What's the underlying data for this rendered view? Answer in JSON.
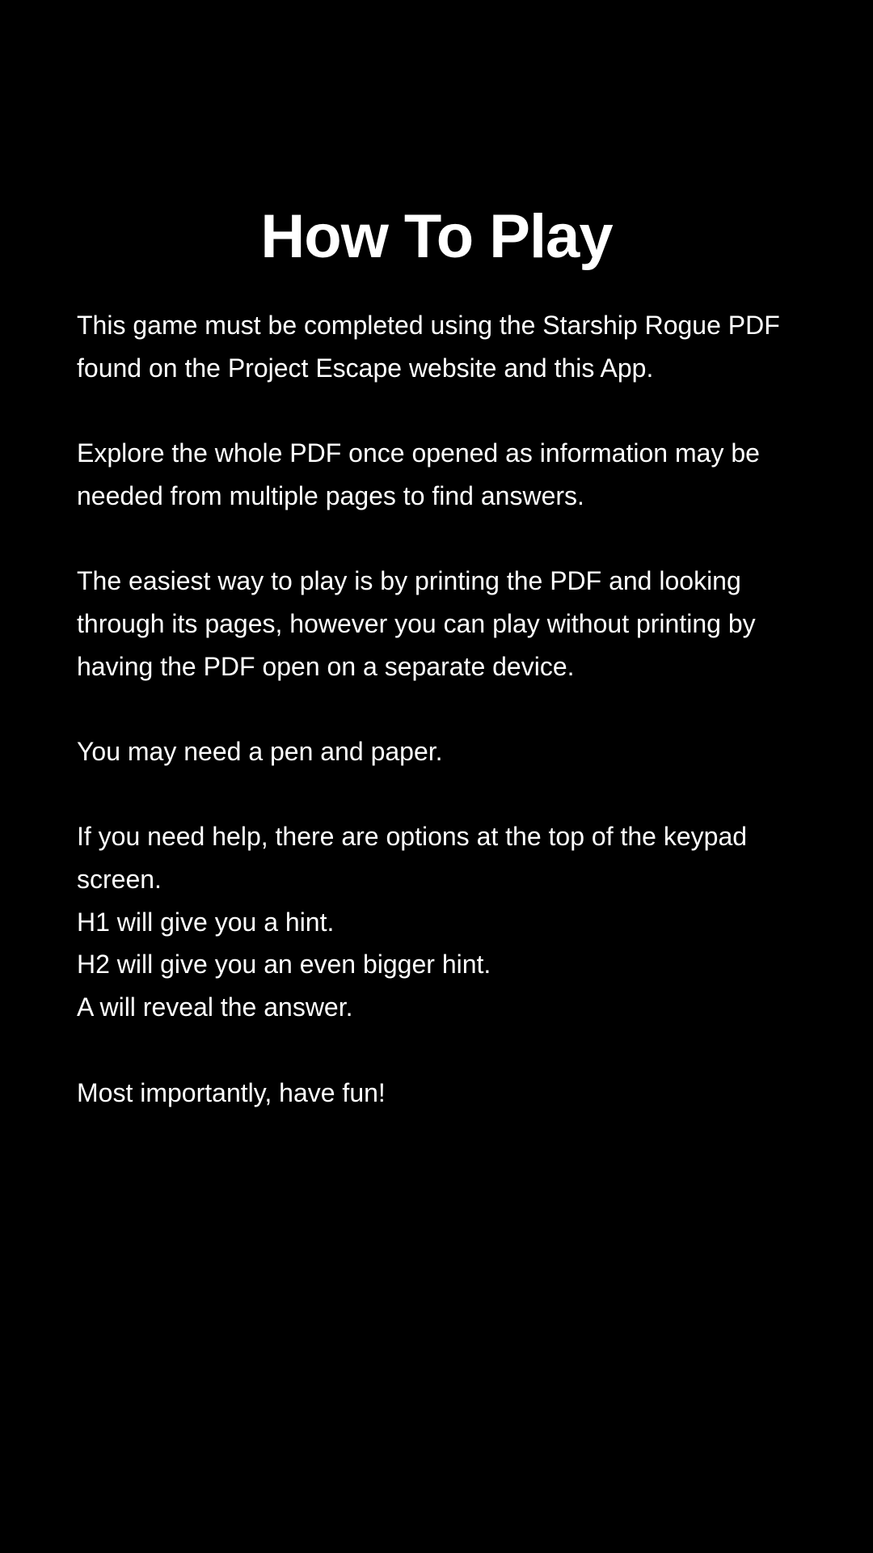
{
  "title": "How To Play",
  "paragraphs": [
    "This game must be completed using the Starship Rogue PDF found on the Project Escape website and this App.",
    "Explore the whole PDF once opened as information may be needed from multiple pages to find answers.",
    "The easiest way to play is by printing the PDF and looking through its pages, however you can play without printing by having the PDF open on a  separate device.",
    "You may need a pen and paper."
  ],
  "help": {
    "intro": "If you need help, there are options at the top of the keypad screen.",
    "h1": "H1 will give you a hint.",
    "h2": "H2 will give you an even bigger hint.",
    "a": "A will reveal the answer."
  },
  "closing": "Most importantly, have fun!"
}
